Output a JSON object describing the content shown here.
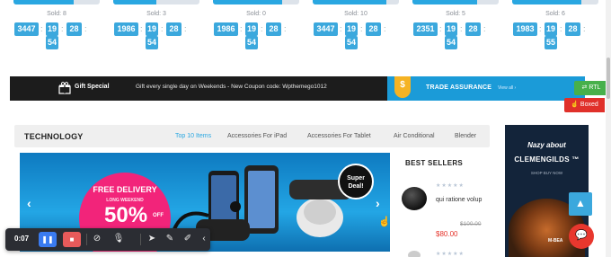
{
  "deals": [
    {
      "sold": "Sold: 8",
      "progress": 0.7,
      "d": "3447",
      "h": "19",
      "m": "54",
      "s": "28"
    },
    {
      "sold": "Sold: 3",
      "progress": 0.5,
      "d": "1986",
      "h": "19",
      "m": "54",
      "s": "28"
    },
    {
      "sold": "Sold: 0",
      "progress": 0.8,
      "d": "1986",
      "h": "19",
      "m": "54",
      "s": "28"
    },
    {
      "sold": "Sold: 10",
      "progress": 0.85,
      "d": "3447",
      "h": "19",
      "m": "54",
      "s": "28"
    },
    {
      "sold": "Sold: 5",
      "progress": 0.75,
      "d": "2351",
      "h": "19",
      "m": "54",
      "s": "28"
    },
    {
      "sold": "Sold: 6",
      "progress": 0.8,
      "d": "1983",
      "h": "19",
      "m": "55",
      "s": "28"
    }
  ],
  "promo": {
    "gift_title": "Gift Special",
    "gift_text": "Gift every single day on Weekends - New Coupon code: Wpthemego1012",
    "trade_title": "TRADE ASSURANCE",
    "trade_view": "View all ›"
  },
  "float": {
    "rtl": "RTL",
    "boxed": "Boxed"
  },
  "category": {
    "title": "TECHNOLOGY",
    "tabs": [
      "Top 10 Items",
      "Accessories For iPad",
      "Accessories For Tablet",
      "Air Conditional",
      "Blender"
    ]
  },
  "slider": {
    "free": "FREE DELIVERY",
    "long": "LONG WEEKEND",
    "pct": "50%",
    "off": "OFF",
    "badge_line1": "Super",
    "badge_line2": "Deal!"
  },
  "bestsellers": {
    "title": "BEST SELLERS",
    "stars": "★★★★★",
    "item_name": "qui ratione volup",
    "old_price": "$100.00",
    "price": "$80.00"
  },
  "sidead": {
    "brand": "Nazy about",
    "name": "CLEMENGILDS ™",
    "buy": "SHOP BUY NOW",
    "plate": "M-BEA"
  },
  "recorder": {
    "time": "0:07"
  },
  "colors": {
    "accent": "#2aa7e1",
    "promo_bg": "#1c1c1c",
    "trade_bg": "#1b9bd8",
    "rtl": "#47b04b",
    "boxed": "#e0302a"
  }
}
